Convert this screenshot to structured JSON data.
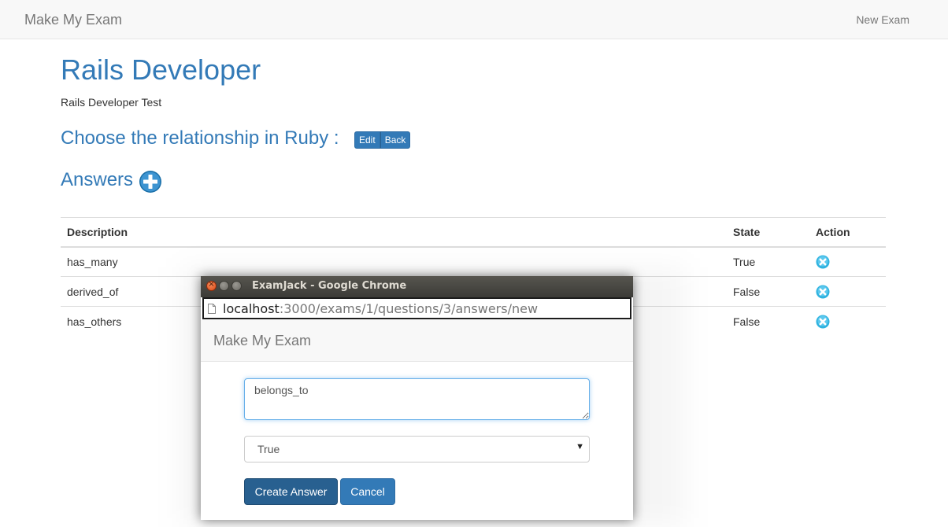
{
  "navbar": {
    "brand": "Make My Exam",
    "new_exam": "New Exam"
  },
  "exam": {
    "title": "Rails Developer",
    "description": "Rails Developer Test"
  },
  "question": {
    "text": "Choose the relationship in Ruby :",
    "edit_label": "Edit",
    "back_label": "Back"
  },
  "answers": {
    "heading": "Answers",
    "add_icon": "plus-circle-icon",
    "columns": {
      "description": "Description",
      "state": "State",
      "action": "Action"
    },
    "rows": [
      {
        "description": "has_many",
        "state": "True",
        "action_icon": "delete-x-icon"
      },
      {
        "description": "derived_of",
        "state": "False",
        "action_icon": "delete-x-icon"
      },
      {
        "description": "has_others",
        "state": "False",
        "action_icon": "delete-x-icon"
      }
    ]
  },
  "popup": {
    "window_title": "ExamJack - Google Chrome",
    "url_host": "localhost",
    "url_path": ":3000/exams/1/questions/3/answers/new",
    "brand": "Make My Exam",
    "description_value": "belongs_to",
    "state_selected": "True",
    "create_label": "Create Answer",
    "cancel_label": "Cancel"
  },
  "colors": {
    "primary": "#337ab7",
    "primary_dark": "#286090",
    "navbar_bg": "#f8f8f8",
    "delete_icon": "#2fb3e0"
  }
}
